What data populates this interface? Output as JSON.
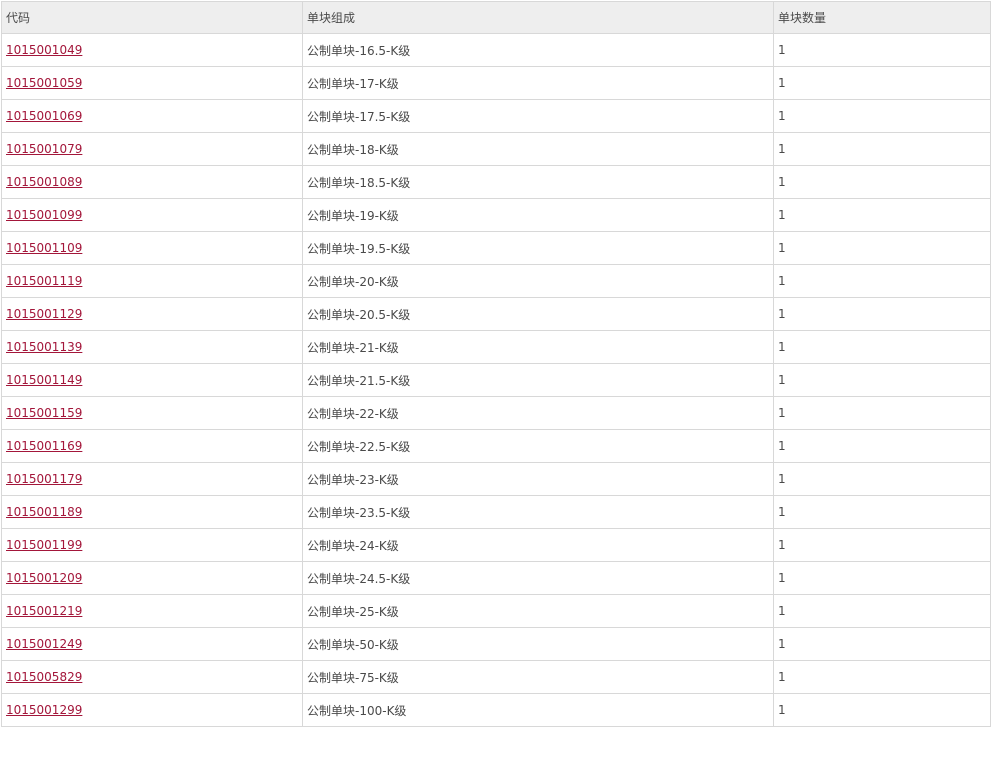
{
  "table": {
    "headers": [
      "代码",
      "单块组成",
      "单块数量"
    ],
    "rows": [
      {
        "code": "1015001049",
        "composition": "公制单块-16.5-K级",
        "quantity": "1"
      },
      {
        "code": "1015001059",
        "composition": "公制单块-17-K级",
        "quantity": "1"
      },
      {
        "code": "1015001069",
        "composition": "公制单块-17.5-K级",
        "quantity": "1"
      },
      {
        "code": "1015001079",
        "composition": "公制单块-18-K级",
        "quantity": "1"
      },
      {
        "code": "1015001089",
        "composition": "公制单块-18.5-K级",
        "quantity": "1"
      },
      {
        "code": "1015001099",
        "composition": "公制单块-19-K级",
        "quantity": "1"
      },
      {
        "code": "1015001109",
        "composition": "公制单块-19.5-K级",
        "quantity": "1"
      },
      {
        "code": "1015001119",
        "composition": "公制单块-20-K级",
        "quantity": "1"
      },
      {
        "code": "1015001129",
        "composition": "公制单块-20.5-K级",
        "quantity": "1"
      },
      {
        "code": "1015001139",
        "composition": "公制单块-21-K级",
        "quantity": "1"
      },
      {
        "code": "1015001149",
        "composition": "公制单块-21.5-K级",
        "quantity": "1"
      },
      {
        "code": "1015001159",
        "composition": "公制单块-22-K级",
        "quantity": "1"
      },
      {
        "code": "1015001169",
        "composition": "公制单块-22.5-K级",
        "quantity": "1"
      },
      {
        "code": "1015001179",
        "composition": "公制单块-23-K级",
        "quantity": "1"
      },
      {
        "code": "1015001189",
        "composition": "公制单块-23.5-K级",
        "quantity": "1"
      },
      {
        "code": "1015001199",
        "composition": "公制单块-24-K级",
        "quantity": "1"
      },
      {
        "code": "1015001209",
        "composition": "公制单块-24.5-K级",
        "quantity": "1"
      },
      {
        "code": "1015001219",
        "composition": "公制单块-25-K级",
        "quantity": "1"
      },
      {
        "code": "1015001249",
        "composition": "公制单块-50-K级",
        "quantity": "1"
      },
      {
        "code": "1015005829",
        "composition": "公制单块-75-K级",
        "quantity": "1"
      },
      {
        "code": "1015001299",
        "composition": "公制单块-100-K级",
        "quantity": "1"
      }
    ]
  },
  "colors": {
    "link": "#a3163a",
    "header_bg": "#eeeeee",
    "border": "#d8d8d8",
    "text": "#4a4a4a"
  }
}
